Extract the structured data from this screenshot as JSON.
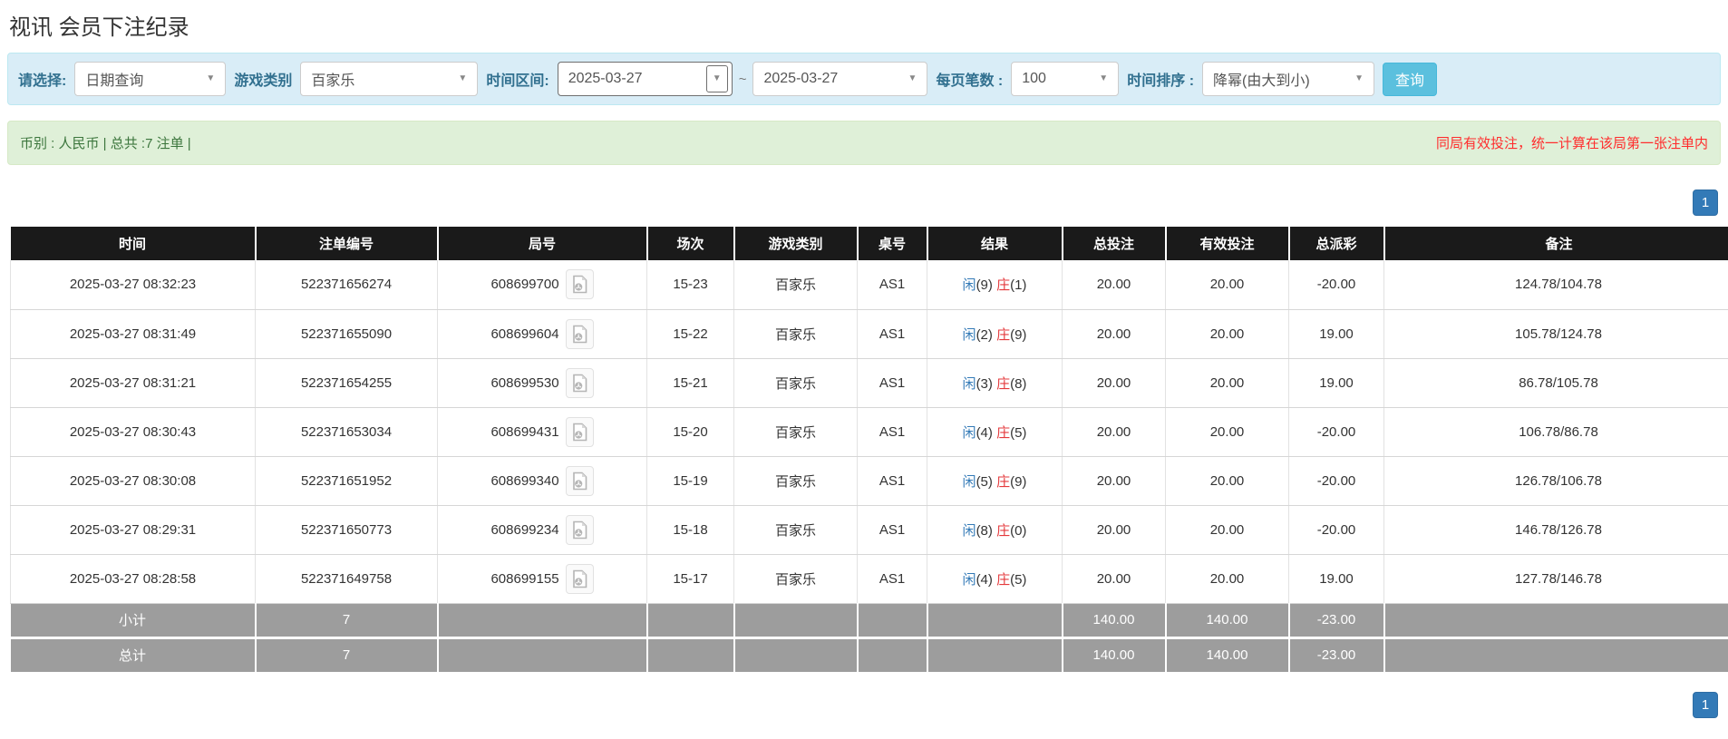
{
  "page": {
    "title": "视讯 会员下注纪录"
  },
  "filters": {
    "query_type_label": "请选择:",
    "query_type_value": "日期查询",
    "game_label": "游戏类别",
    "game_value": "百家乐",
    "range_label": "时间区间:",
    "date_from": "2025-03-27",
    "date_to": "2025-03-27",
    "range_separator": "~",
    "page_size_label": "每页笔数 :",
    "page_size_value": "100",
    "sort_label": "时间排序 :",
    "sort_value": "降幂(由大到小)",
    "search_button": "查询"
  },
  "summary": {
    "currency_info": "币别 : 人民币 | 总共 :7 注单 |",
    "notice": "同局有效投注，统一计算在该局第一张注单内"
  },
  "pagination": {
    "current_page": "1"
  },
  "table": {
    "headers": [
      "时间",
      "注单编号",
      "局号",
      "场次",
      "游戏类别",
      "桌号",
      "结果",
      "总投注",
      "有效投注",
      "总派彩",
      "备注"
    ],
    "rows": [
      {
        "time": "2025-03-27 08:32:23",
        "bet_id": "522371656274",
        "round": "608699700",
        "session": "15-23",
        "game": "百家乐",
        "table_no": "AS1",
        "result": {
          "player_label": "闲",
          "player_score": "(9)",
          "banker_label": "庄",
          "banker_score": "(1)"
        },
        "total_bet": "20.00",
        "valid_bet": "20.00",
        "payout": "-20.00",
        "remark": "124.78/104.78"
      },
      {
        "time": "2025-03-27 08:31:49",
        "bet_id": "522371655090",
        "round": "608699604",
        "session": "15-22",
        "game": "百家乐",
        "table_no": "AS1",
        "result": {
          "player_label": "闲",
          "player_score": "(2)",
          "banker_label": "庄",
          "banker_score": "(9)"
        },
        "total_bet": "20.00",
        "valid_bet": "20.00",
        "payout": "19.00",
        "remark": "105.78/124.78"
      },
      {
        "time": "2025-03-27 08:31:21",
        "bet_id": "522371654255",
        "round": "608699530",
        "session": "15-21",
        "game": "百家乐",
        "table_no": "AS1",
        "result": {
          "player_label": "闲",
          "player_score": "(3)",
          "banker_label": "庄",
          "banker_score": "(8)"
        },
        "total_bet": "20.00",
        "valid_bet": "20.00",
        "payout": "19.00",
        "remark": "86.78/105.78"
      },
      {
        "time": "2025-03-27 08:30:43",
        "bet_id": "522371653034",
        "round": "608699431",
        "session": "15-20",
        "game": "百家乐",
        "table_no": "AS1",
        "result": {
          "player_label": "闲",
          "player_score": "(4)",
          "banker_label": "庄",
          "banker_score": "(5)"
        },
        "total_bet": "20.00",
        "valid_bet": "20.00",
        "payout": "-20.00",
        "remark": "106.78/86.78"
      },
      {
        "time": "2025-03-27 08:30:08",
        "bet_id": "522371651952",
        "round": "608699340",
        "session": "15-19",
        "game": "百家乐",
        "table_no": "AS1",
        "result": {
          "player_label": "闲",
          "player_score": "(5)",
          "banker_label": "庄",
          "banker_score": "(9)"
        },
        "total_bet": "20.00",
        "valid_bet": "20.00",
        "payout": "-20.00",
        "remark": "126.78/106.78"
      },
      {
        "time": "2025-03-27 08:29:31",
        "bet_id": "522371650773",
        "round": "608699234",
        "session": "15-18",
        "game": "百家乐",
        "table_no": "AS1",
        "result": {
          "player_label": "闲",
          "player_score": "(8)",
          "banker_label": "庄",
          "banker_score": "(0)"
        },
        "total_bet": "20.00",
        "valid_bet": "20.00",
        "payout": "-20.00",
        "remark": "146.78/126.78"
      },
      {
        "time": "2025-03-27 08:28:58",
        "bet_id": "522371649758",
        "round": "608699155",
        "session": "15-17",
        "game": "百家乐",
        "table_no": "AS1",
        "result": {
          "player_label": "闲",
          "player_score": "(4)",
          "banker_label": "庄",
          "banker_score": "(5)"
        },
        "total_bet": "20.00",
        "valid_bet": "20.00",
        "payout": "19.00",
        "remark": "127.78/146.78"
      }
    ],
    "footer_rows": [
      {
        "label": "小计",
        "count": "7",
        "total_bet": "140.00",
        "valid_bet": "140.00",
        "payout": "-23.00"
      },
      {
        "label": "总计",
        "count": "7",
        "total_bet": "140.00",
        "valid_bet": "140.00",
        "payout": "-23.00"
      }
    ]
  },
  "icons": {
    "dropdown_caret": "▼",
    "video_icon": "video-replay-document"
  },
  "colors": {
    "accent_blue": "#337ab7",
    "danger_red": "#ff2d2d",
    "banker_red": "#e4393c",
    "label_blue": "#31708f",
    "panel_bg": "#d9edf7",
    "panel_border": "#bce8f1",
    "success_bg": "#dff0d8",
    "success_border": "#d6e9c6",
    "success_text": "#3c763d",
    "header_bg": "#1a1a1a",
    "footer_bg": "#9d9d9d",
    "search_btn": "#5bc0de"
  }
}
